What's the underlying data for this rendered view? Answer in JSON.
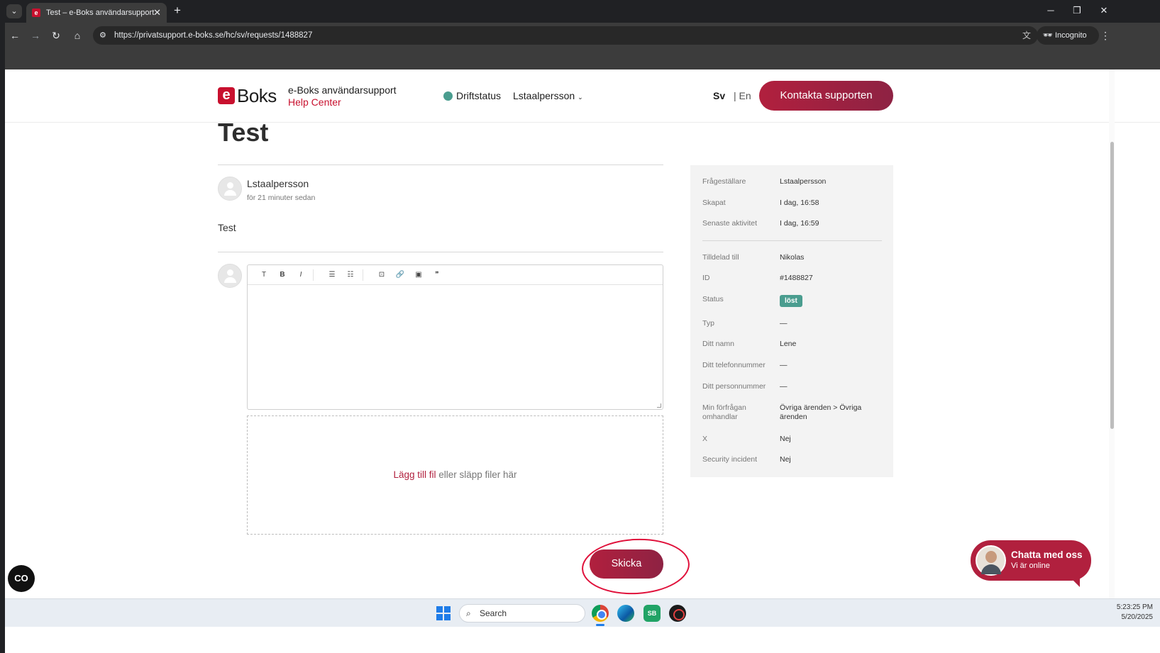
{
  "browser": {
    "tab_title": "Test – e-Boks användarsupport",
    "tab_favicon": "e",
    "url": "https://privatsupport.e-boks.se/hc/sv/requests/1488827",
    "incognito_label": "Incognito"
  },
  "header": {
    "logo_mark": "e",
    "logo_text": "Boks",
    "brand_title": "e-Boks användarsupport",
    "brand_subtitle": "Help Center",
    "status_label": "Driftstatus",
    "status_color": "#4a9d8f",
    "user_menu_label": "Lstaalpersson",
    "lang_active": "Sv",
    "lang_separator": "|",
    "lang_other": "En",
    "contact_button_label": "Kontakta supporten"
  },
  "request": {
    "title": "Test",
    "author": "Lstaalpersson",
    "time_ago": "för 21 minuter sedan",
    "body": "Test"
  },
  "editor": {
    "tools": [
      {
        "icon": "text-format-icon",
        "glyph": "T"
      },
      {
        "icon": "bold-icon",
        "glyph": "B"
      },
      {
        "icon": "italic-icon",
        "glyph": "I"
      },
      {
        "icon": "bullet-list-icon",
        "glyph": "☰"
      },
      {
        "icon": "numbered-list-icon",
        "glyph": "☷"
      },
      {
        "icon": "code-block-icon",
        "glyph": "⊡"
      },
      {
        "icon": "link-icon",
        "glyph": "🔗"
      },
      {
        "icon": "image-icon",
        "glyph": "▣"
      },
      {
        "icon": "quote-icon",
        "glyph": "❞"
      }
    ],
    "dropzone_link": "Lägg till fil",
    "dropzone_text": " eller släpp filer här",
    "submit_label": "Skicka"
  },
  "details": {
    "group1": [
      {
        "label": "Frågeställare",
        "value": "Lstaalpersson"
      },
      {
        "label": "Skapat",
        "value": "I dag, 16:58"
      },
      {
        "label": "Senaste aktivitet",
        "value": "I dag, 16:59"
      }
    ],
    "group2": [
      {
        "label": "Tilldelad till",
        "value": "Nikolas"
      },
      {
        "label": "ID",
        "value": "#1488827"
      },
      {
        "label": "Status",
        "value": "löst"
      },
      {
        "label": "Typ",
        "value": "—"
      },
      {
        "label": "Ditt namn",
        "value": "Lene"
      },
      {
        "label": "Ditt telefonnummer",
        "value": "—"
      },
      {
        "label": "Ditt personnummer",
        "value": "—"
      },
      {
        "label": "Min förfrågan omhandlar",
        "value": "Övriga ärenden > Övriga ärenden"
      },
      {
        "label": "X",
        "value": "Nej"
      },
      {
        "label": "Security incident",
        "value": "Nej"
      }
    ],
    "status_badge_color": "#4a9d8f"
  },
  "widgets": {
    "a11y_label": "CO",
    "chat_title": "Chatta med oss",
    "chat_subtitle": "Vi är online"
  },
  "taskbar": {
    "search_placeholder": "Search",
    "sheets_label": "SB",
    "clock_time": "5:23:25 PM",
    "clock_date": "5/20/2025"
  },
  "colors": {
    "brand_red": "#c8102e",
    "button_gradient_start": "#b1203e",
    "button_gradient_end": "#8e2243",
    "annotation_circle": "#e0113b"
  }
}
